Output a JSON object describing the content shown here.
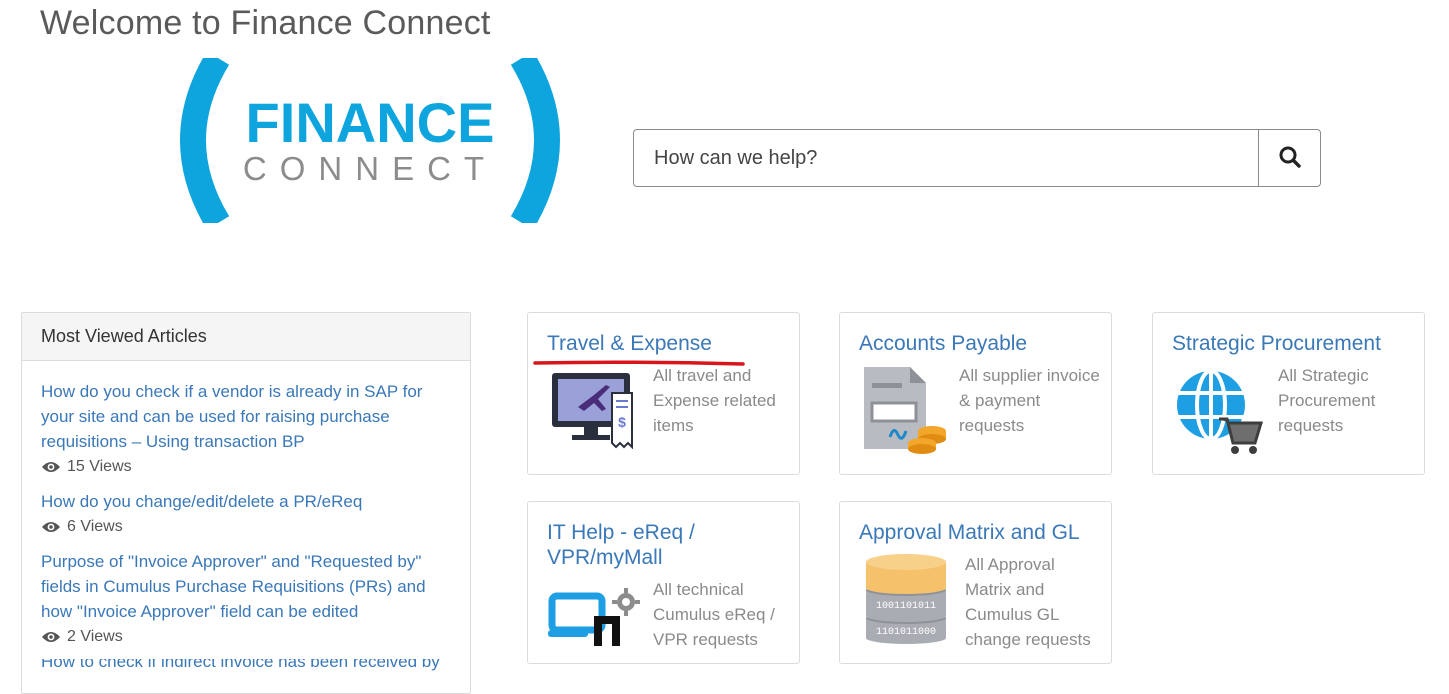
{
  "page": {
    "title": "Welcome to Finance Connect"
  },
  "logo": {
    "word1": "FINANCE",
    "word2": "CONNECT"
  },
  "search": {
    "placeholder": "How can we help?"
  },
  "articles": {
    "heading": "Most Viewed Articles",
    "items": [
      {
        "title": "How do you check if a vendor is already in SAP for your site and can be used for raising purchase requisitions – Using transaction BP",
        "views": "15 Views"
      },
      {
        "title": "How do you change/edit/delete a PR/eReq",
        "views": "6 Views"
      },
      {
        "title": "Purpose of \"Invoice Approver\" and \"Requested by\" fields in Cumulus Purchase Requisitions (PRs) and how \"Invoice Approver\" field can be edited",
        "views": "2 Views"
      },
      {
        "title": "How to check if indirect invoice has been received by",
        "views": ""
      }
    ]
  },
  "cards": [
    {
      "title": "Travel & Expense",
      "desc": "All travel and Expense related items",
      "icon": "travel-monitor-icon"
    },
    {
      "title": "Accounts Payable",
      "desc": "All supplier invoice & payment requests",
      "icon": "invoice-coins-icon"
    },
    {
      "title": "Strategic Procurement",
      "desc": "All Strategic Procurement requests",
      "icon": "globe-cart-icon"
    },
    {
      "title": "IT Help - eReq / VPR/myMall",
      "desc": "All technical Cumulus eReq / VPR requests",
      "icon": "laptop-gear-icon"
    },
    {
      "title": "Approval Matrix and GL",
      "desc": "All Approval Matrix and Cumulus GL change requests",
      "icon": "database-icon"
    }
  ],
  "colors": {
    "link": "#3a78b8",
    "logo_blue": "#0ea5df",
    "logo_gray": "#8c8c8c",
    "highlight_underline": "#d9151b"
  }
}
